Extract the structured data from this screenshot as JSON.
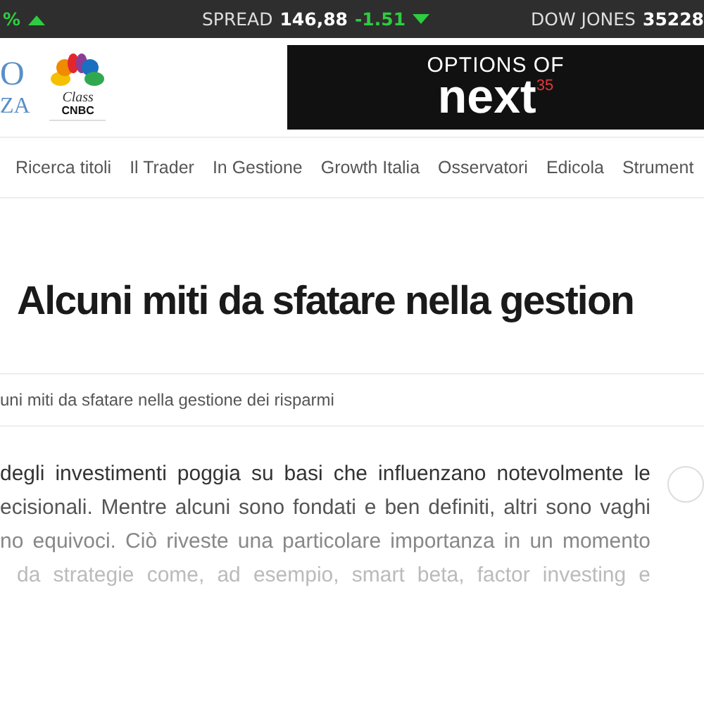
{
  "ticker": [
    {
      "change": "%",
      "up": true
    },
    {
      "label": "SPREAD",
      "value": "146,88",
      "change": "-1.51",
      "up": false
    },
    {
      "label": "DOW JONES",
      "value": "35228"
    }
  ],
  "logo": {
    "letters_top": "O",
    "letters_bottom": "ZA",
    "partner_top": "Class",
    "partner_bottom": "CNBC"
  },
  "ad_banner": {
    "line_1": "OPTIONS OF",
    "line_2": "next",
    "badge": "35"
  },
  "nav": [
    "Ricerca titoli",
    "Il Trader",
    "In Gestione",
    "Growth Italia",
    "Osservatori",
    "Edicola",
    "Strument"
  ],
  "article": {
    "title": "Alcuni miti da sfatare nella gestion",
    "breadcrumb": "uni miti da sfatare nella gestione dei risparmi",
    "lines": [
      "degli investimenti poggia su basi che influenzano notevolmente le",
      "ecisionali. Mentre alcuni sono fondati e ben definiti, altri sono vaghi",
      "no equivoci. Ciò riveste una particolare importanza in un momento",
      "da strategie come, ad esempio, smart beta, factor investing e"
    ]
  }
}
